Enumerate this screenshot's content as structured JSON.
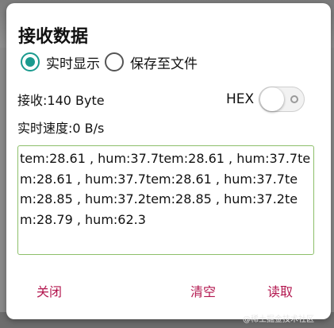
{
  "dialog": {
    "title": "接收数据",
    "display_mode": {
      "options": [
        {
          "label": "实时显示",
          "checked": true
        },
        {
          "label": "保存至文件",
          "checked": false
        }
      ]
    },
    "received_label": "接收:140 Byte",
    "speed_label": "实时速度:0 B/s",
    "hex": {
      "label": "HEX",
      "enabled": false
    },
    "data_text": "tem:28.61 , hum:37.7tem:28.61 , hum:37.7tem:28.61 , hum:37.7tem:28.61 , hum:37.7tem:28.85 , hum:37.2tem:28.85 , hum:37.2tem:28.79 , hum:62.3",
    "buttons": {
      "close": "关闭",
      "clear": "清空",
      "read": "读取"
    }
  },
  "watermark": "@稀土掘金技术社区",
  "colors": {
    "accent": "#1a9a8e",
    "button_text": "#b3174f",
    "textbox_border": "#8dbf6a"
  }
}
